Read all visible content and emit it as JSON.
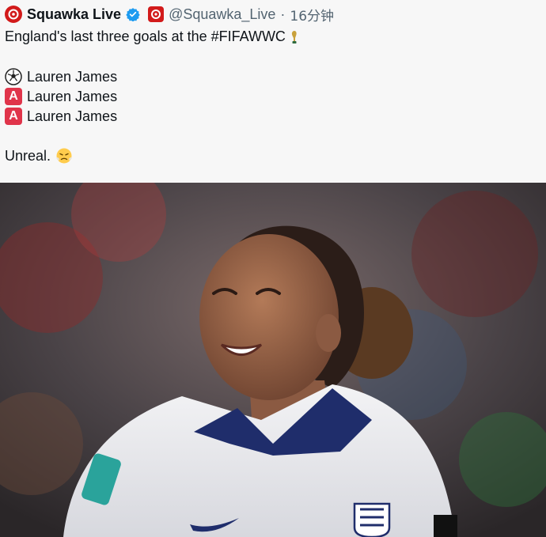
{
  "tweet": {
    "author_name": "Squawka Live",
    "handle": "@Squawka_Live",
    "separator": "·",
    "time": "16分钟",
    "text_line1": "England's last three goals at the #FIFAWWC",
    "goals": [
      {
        "icon": "soccer-ball-icon",
        "label": "Lauren James"
      },
      {
        "icon": "a-button-icon",
        "badge": "A",
        "label": "Lauren James"
      },
      {
        "icon": "a-button-icon",
        "badge": "A",
        "label": "Lauren James"
      }
    ],
    "closing": "Unreal.",
    "closing_emoji": "face-with-steam-icon"
  },
  "colors": {
    "brand_red": "#d21a1a",
    "verified_blue": "#1d9bf0",
    "a_badge": "#e0344a",
    "muted": "#536471"
  },
  "media": {
    "alt_subject": "smiling-player-photo"
  }
}
